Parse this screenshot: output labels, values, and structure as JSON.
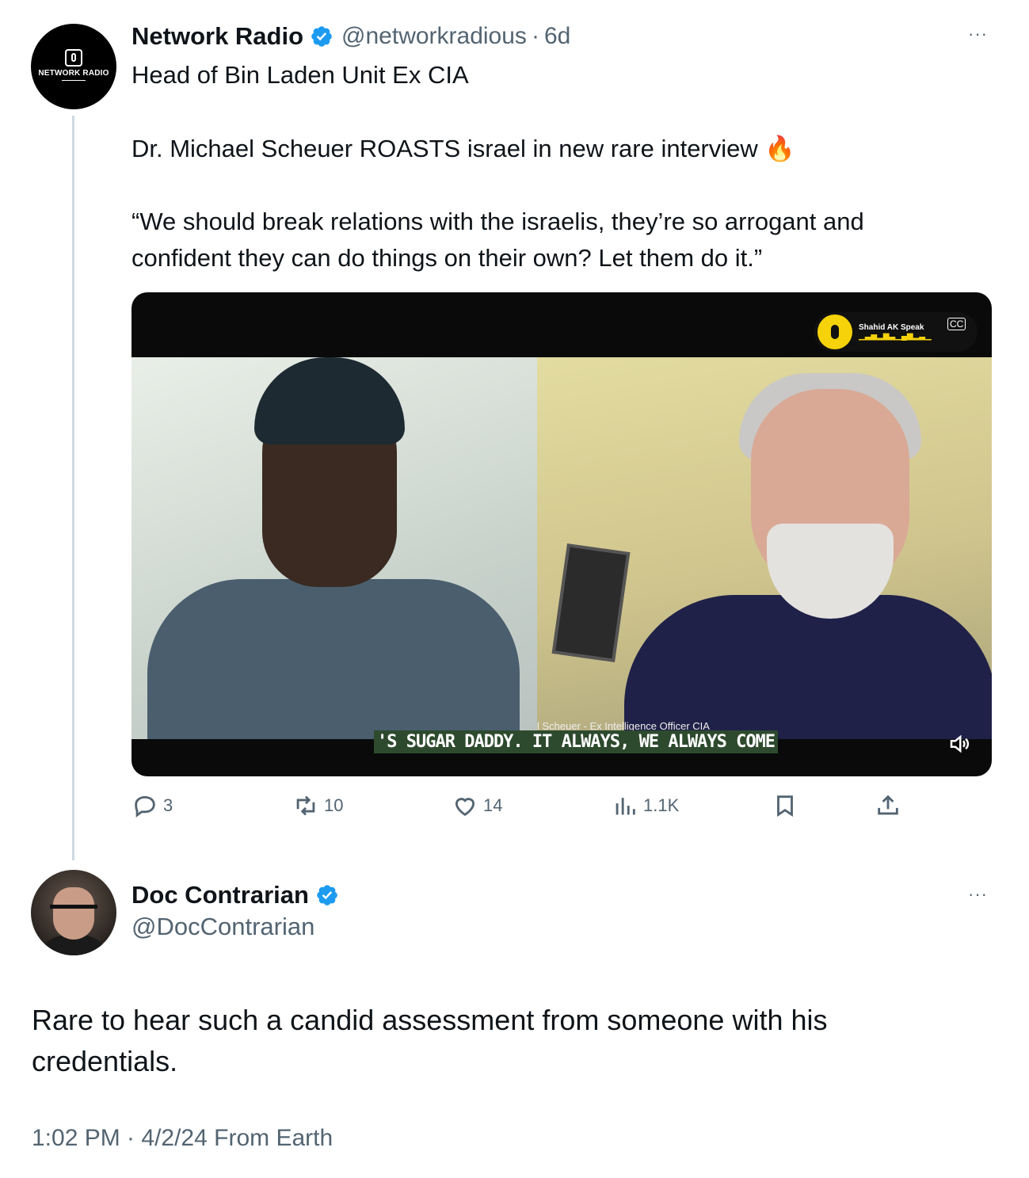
{
  "tweet": {
    "author_name": "Network Radio",
    "author_handle": "@networkradious",
    "separator": "·",
    "time_ago": "6d",
    "avatar_text": "NETWORK RADIO",
    "more": "···",
    "lines": [
      "Head of Bin Laden Unit Ex CIA",
      "Dr. Michael Scheuer ROASTS israel in new rare interview 🔥",
      "“We should break relations with the israelis, they’re so arrogant and",
      "confident they can do things on their own? Let them do it.”"
    ],
    "video": {
      "badge_title": "Shahid AK Speak",
      "lower_third": "l Scheuer - Ex Intelligence Officer CIA",
      "caption": "'S SUGAR DADDY. IT ALWAYS, WE ALWAYS COME"
    },
    "actions": {
      "replies": "3",
      "retweets": "10",
      "likes": "14",
      "views": "1.1K"
    }
  },
  "reply": {
    "author_name": "Doc Contrarian",
    "author_handle": "@DocContrarian",
    "more": "···",
    "lines": [
      "Rare to hear such a candid assessment from someone with his",
      "credentials."
    ],
    "meta": "1:02 PM · 4/2/24 From Earth"
  },
  "colors": {
    "verified": "#1d9bf0",
    "secondary_text": "#536471",
    "thread_line": "#cfd9de"
  }
}
